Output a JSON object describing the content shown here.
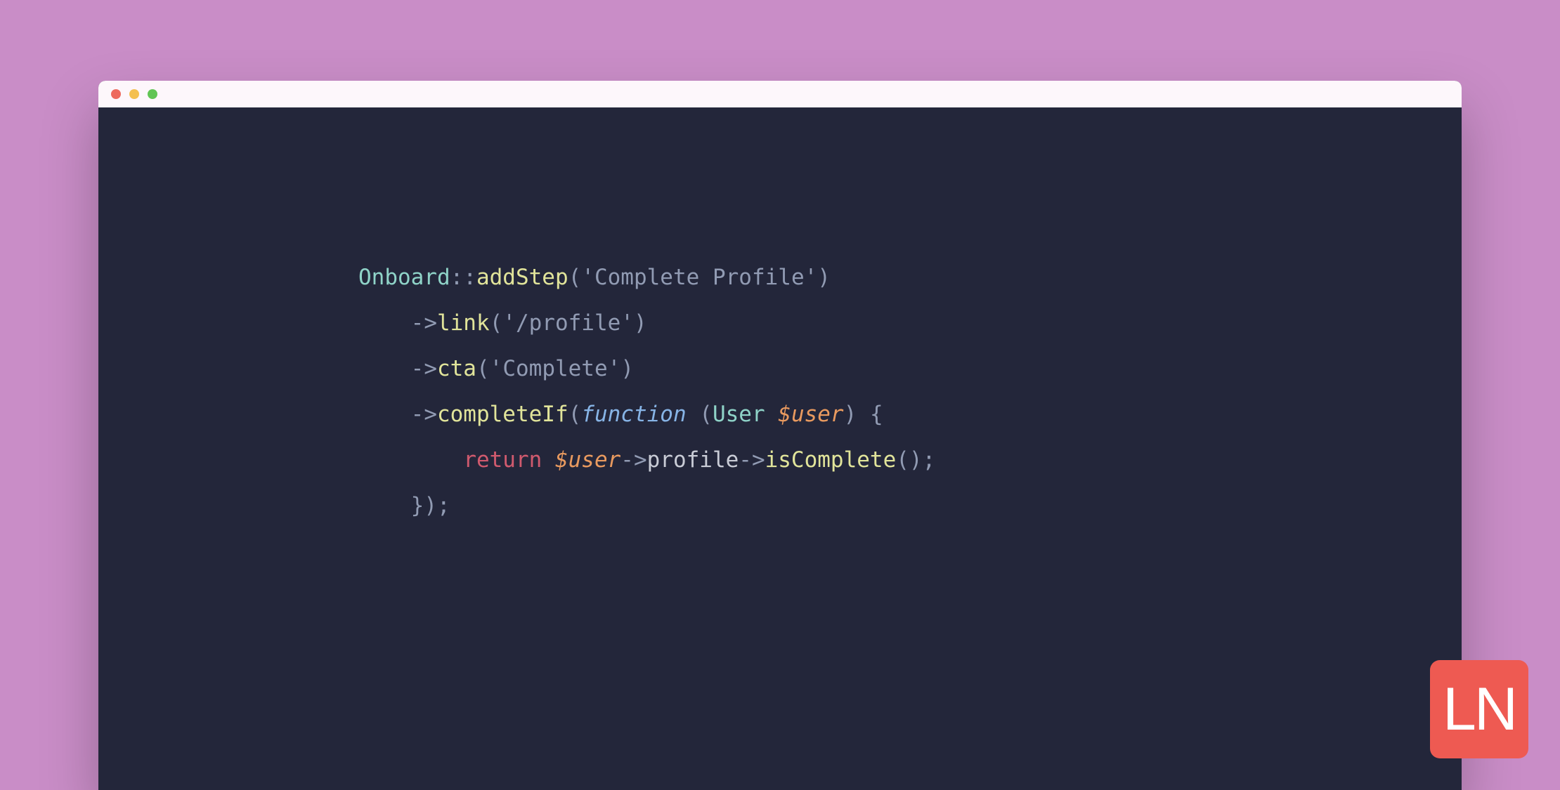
{
  "colors": {
    "background": "#c98dc7",
    "editor_bg": "#23263a",
    "titlebar_bg": "#fdf7fb",
    "logo_bg": "#ee5a52"
  },
  "traffic_lights": [
    "red",
    "yellow",
    "green"
  ],
  "code": {
    "line1": {
      "class": "Onboard",
      "double_colon": "::",
      "method": "addStep",
      "open": "(",
      "q1": "'",
      "string": "Complete Profile",
      "q2": "'",
      "close": ")"
    },
    "line2": {
      "indent": "    ",
      "arrow": "->",
      "method": "link",
      "open": "(",
      "q1": "'",
      "string": "/profile",
      "q2": "'",
      "close": ")"
    },
    "line3": {
      "indent": "    ",
      "arrow": "->",
      "method": "cta",
      "open": "(",
      "q1": "'",
      "string": "Complete",
      "q2": "'",
      "close": ")"
    },
    "line4": {
      "indent": "    ",
      "arrow": "->",
      "method": "completeIf",
      "open": "(",
      "keyword": "function",
      "space": " ",
      "popen": "(",
      "type": "User",
      "space2": " ",
      "var": "$user",
      "pclose": ")",
      "space3": " ",
      "brace": "{"
    },
    "line5": {
      "indent": "        ",
      "return": "return",
      "space": " ",
      "var": "$user",
      "arrow1": "->",
      "prop": "profile",
      "arrow2": "->",
      "call": "isComplete",
      "open": "(",
      "close": ")",
      "semi": ";"
    },
    "line6": {
      "indent": "    ",
      "brace": "}",
      "close": ")",
      "semi": ";"
    }
  },
  "logo": {
    "text": "LN"
  }
}
